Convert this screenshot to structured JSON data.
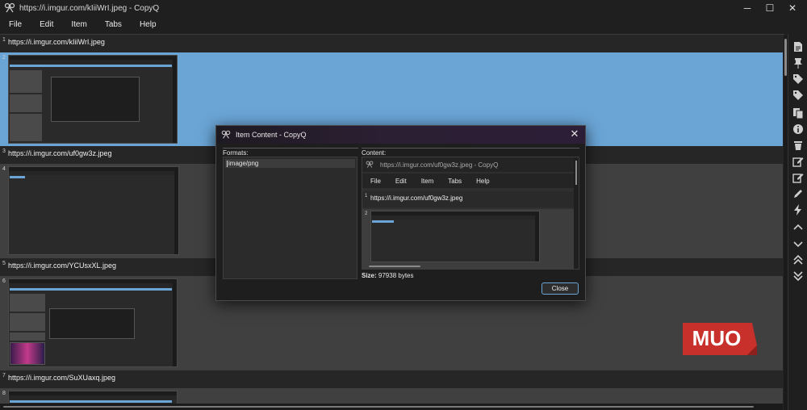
{
  "window": {
    "title": "https://i.imgur.com/kIiiWrI.jpeg - CopyQ",
    "minimize_glyph": "─",
    "maximize_glyph": "☐",
    "close_glyph": "✕"
  },
  "menu": [
    "File",
    "Edit",
    "Item",
    "Tabs",
    "Help"
  ],
  "list": {
    "items": [
      {
        "num": "1",
        "text": "https://i.imgur.com/kIiiWrI.jpeg",
        "type": "text"
      },
      {
        "num": "2",
        "type": "image",
        "selected": true
      },
      {
        "num": "3",
        "text": "https://i.imgur.com/uf0gw3z.jpeg",
        "type": "text"
      },
      {
        "num": "4",
        "type": "image"
      },
      {
        "num": "5",
        "text": "https://i.imgur.com/YCUsxXL.jpeg",
        "type": "text"
      },
      {
        "num": "6",
        "type": "image"
      },
      {
        "num": "7",
        "text": "https://i.imgur.com/SuXUaxq.jpeg",
        "type": "text"
      },
      {
        "num": "8",
        "type": "image"
      }
    ]
  },
  "sidebar_icons": [
    "new-document-icon",
    "pin-icon",
    "tag-icon",
    "tag-outline-icon",
    "copy-icon",
    "info-icon",
    "delete-icon",
    "edit-icon",
    "edit-alt-icon",
    "pencil-icon",
    "bolt-icon",
    "chevron-up-icon",
    "chevron-down-icon",
    "double-chevron-up-icon",
    "double-chevron-down-icon"
  ],
  "logo": {
    "text": "MUO",
    "color": "#c8302c"
  },
  "dialog": {
    "title": "Item Content - CopyQ",
    "close_glyph": "✕",
    "formats_label": "Formats:",
    "formats": [
      "image/png"
    ],
    "content_label": "Content:",
    "preview": {
      "window_title": "https://i.imgur.com/uf0gw3z.jpeg - CopyQ",
      "menu": [
        "File",
        "Edit",
        "Item",
        "Tabs",
        "Help"
      ],
      "row1_num": "1",
      "row1_text": "https://i.imgur.com/uf0gw3z.jpeg",
      "row2_num": "2"
    },
    "size_label": "Size:",
    "size_value": "97938 bytes",
    "close_button": "Close"
  },
  "colors": {
    "selection": "#6aa5d6",
    "background": "#1f1f1f",
    "dialog_title_gradient_end": "#2c1e36"
  }
}
